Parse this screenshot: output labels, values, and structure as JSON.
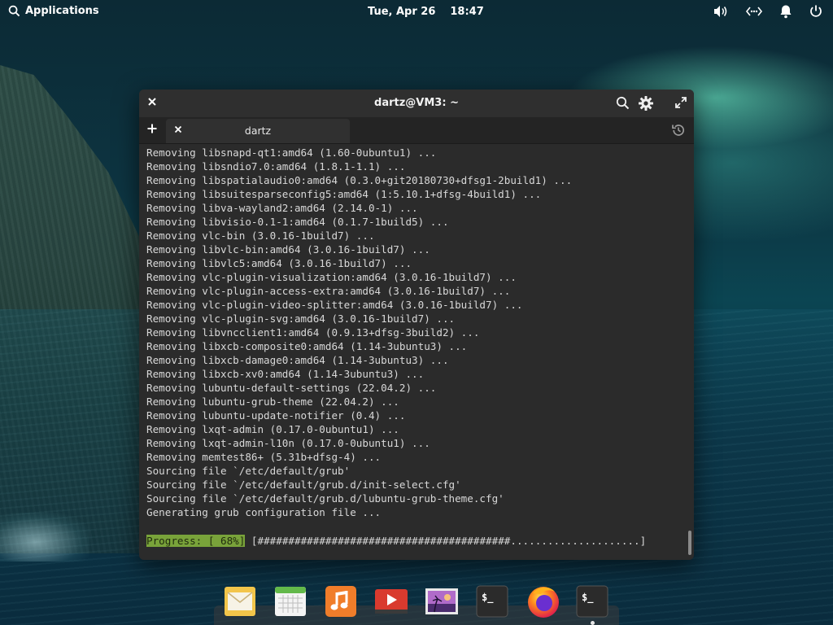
{
  "panel": {
    "applications_label": "Applications",
    "date": "Tue, Apr 26",
    "time": "18:47"
  },
  "window": {
    "title": "dartz@VM3: ~",
    "tab_label": "dartz"
  },
  "terminal": {
    "lines": [
      "Removing libsnapd-qt1:amd64 (1.60-0ubuntu1) ...",
      "Removing libsndio7.0:amd64 (1.8.1-1.1) ...",
      "Removing libspatialaudio0:amd64 (0.3.0+git20180730+dfsg1-2build1) ...",
      "Removing libsuitesparseconfig5:amd64 (1:5.10.1+dfsg-4build1) ...",
      "Removing libva-wayland2:amd64 (2.14.0-1) ...",
      "Removing libvisio-0.1-1:amd64 (0.1.7-1build5) ...",
      "Removing vlc-bin (3.0.16-1build7) ...",
      "Removing libvlc-bin:amd64 (3.0.16-1build7) ...",
      "Removing libvlc5:amd64 (3.0.16-1build7) ...",
      "Removing vlc-plugin-visualization:amd64 (3.0.16-1build7) ...",
      "Removing vlc-plugin-access-extra:amd64 (3.0.16-1build7) ...",
      "Removing vlc-plugin-video-splitter:amd64 (3.0.16-1build7) ...",
      "Removing vlc-plugin-svg:amd64 (3.0.16-1build7) ...",
      "Removing libvncclient1:amd64 (0.9.13+dfsg-3build2) ...",
      "Removing libxcb-composite0:amd64 (1.14-3ubuntu3) ...",
      "Removing libxcb-damage0:amd64 (1.14-3ubuntu3) ...",
      "Removing libxcb-xv0:amd64 (1.14-3ubuntu3) ...",
      "Removing lubuntu-default-settings (22.04.2) ...",
      "Removing lubuntu-grub-theme (22.04.2) ...",
      "Removing lubuntu-update-notifier (0.4) ...",
      "Removing lxqt-admin (0.17.0-0ubuntu1) ...",
      "Removing lxqt-admin-l10n (0.17.0-0ubuntu1) ...",
      "Removing memtest86+ (5.31b+dfsg-4) ...",
      "Sourcing file `/etc/default/grub'",
      "Sourcing file `/etc/default/grub.d/init-select.cfg'",
      "Sourcing file `/etc/default/grub.d/lubuntu-grub-theme.cfg'",
      "Generating grub configuration file ..."
    ],
    "progress_label": "Progress: [ 68%]",
    "progress_bar": "[#########################################.....................]",
    "progress_fraction": 0.68
  },
  "dock": {
    "items": [
      "mail-app",
      "calendar-app",
      "music-app",
      "videos-app",
      "photos-app",
      "terminal-app",
      "firefox-app",
      "terminal-app-running"
    ]
  }
}
